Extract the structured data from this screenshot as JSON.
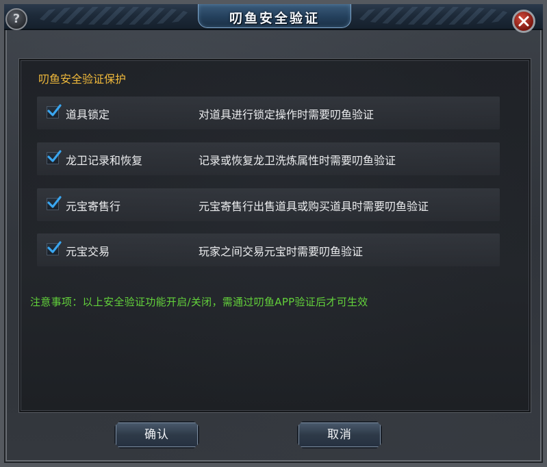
{
  "window": {
    "title": "叨鱼安全验证",
    "help_glyph": "?"
  },
  "section": {
    "title": "叨鱼安全验证保护"
  },
  "options": [
    {
      "label": "道具锁定",
      "description": "对道具进行锁定操作时需要叨鱼验证",
      "checked": true
    },
    {
      "label": "龙卫记录和恢复",
      "description": "记录或恢复龙卫洗炼属性时需要叨鱼验证",
      "checked": true
    },
    {
      "label": "元宝寄售行",
      "description": "元宝寄售行出售道具或购买道具时需要叨鱼验证",
      "checked": true
    },
    {
      "label": "元宝交易",
      "description": "玩家之间交易元宝时需要叨鱼验证",
      "checked": true
    }
  ],
  "notice": "注意事项：以上安全验证功能开启/关闭，需通过叨鱼APP验证后才可生效",
  "buttons": {
    "confirm": "确认",
    "cancel": "取消"
  },
  "colors": {
    "section_title": "#f0b93b",
    "notice": "#63d23b",
    "checkmark": "#3aa6f0",
    "close": "#b02a1c"
  },
  "icons": {
    "help": "question-icon",
    "close": "close-icon",
    "check": "checkmark-icon"
  }
}
